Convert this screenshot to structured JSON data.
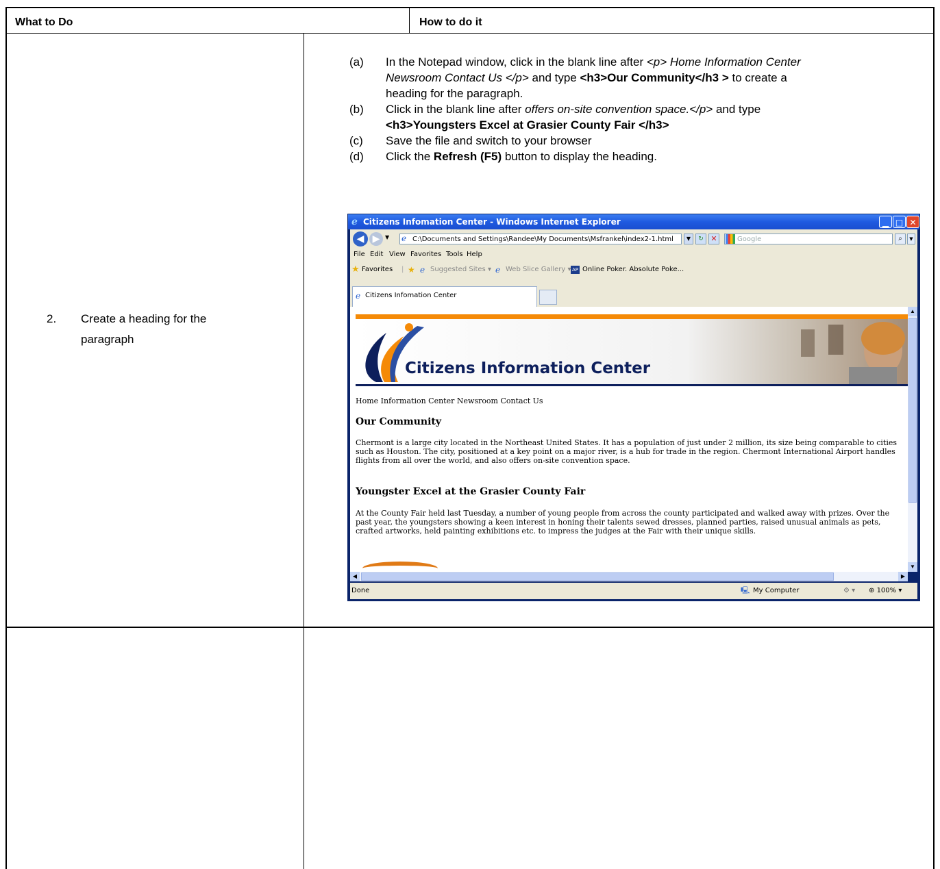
{
  "table": {
    "col1_header": "What to Do",
    "col2_header": "How to do it"
  },
  "step": {
    "number": "2.",
    "text_line1": "Create a heading for the",
    "text_line2": "paragraph"
  },
  "instructions": {
    "a": {
      "label": "(a)",
      "l1_part1": "In the Notepad window, click in the blank line after ",
      "l1_italic": "<p> Home Information Center",
      "l2_italic": "Newsroom Contact Us </p>",
      "l2_mid": " and type ",
      "l2_bold": "<h3>Our Community</h3 >",
      "l2_end": " to create a",
      "l3": "heading for the paragraph."
    },
    "b": {
      "label": "(b)",
      "l1_part1": "Click in the blank line after ",
      "l1_italic": "offers on-site convention space.</p>",
      "l1_end": " and type",
      "l2_bold": "<h3>Youngsters Excel at Grasier County Fair </h3>"
    },
    "c": {
      "label": "(c)",
      "text": "Save the file and switch to your browser"
    },
    "d": {
      "label": "(d)",
      "pre": "Click the ",
      "bold": "Refresh (F5)",
      "post": " button to display the heading."
    }
  },
  "browser": {
    "window_title": "Citizens Infomation Center - Windows Internet Explorer",
    "address": "C:\\Documents and Settings\\Randee\\My Documents\\Msfrankel\\index2-1.html",
    "search_placeholder": "Google",
    "menu": [
      "File",
      "Edit",
      "View",
      "Favorites",
      "Tools",
      "Help"
    ],
    "favorites_label": "Favorites",
    "fav_links": [
      "Suggested Sites",
      "Web Slice Gallery",
      "Online Poker. Absolute Poke..."
    ],
    "tab_label": "Citizens Infomation Center",
    "status_text": "Done",
    "zone": "My Computer",
    "zoom": "100%",
    "page": {
      "banner_text": "Citizens Information Center",
      "nav": "Home Information Center Newsroom Contact Us",
      "h1": "Our Community",
      "p1": "Chermont is a large city located in the Northeast United States. It has a population of just under 2 million, its size being comparable to cities such as Houston. The city, positioned at a key point on a major river, is a hub for trade in the region. Chermont International Airport handles flights from all over the world, and also offers on-site convention space.",
      "h2": "Youngster Excel at the Grasier County Fair",
      "p2": "At the County Fair held last Tuesday, a number of young people from across the county participated and walked away with prizes. Over the past year, the youngsters showing a keen interest in honing their talents sewed dresses, planned parties, raised unusual animals as pets, crafted artworks, held painting exhibitions etc. to impress the judges at the Fair with their unique skills."
    }
  },
  "colors": {
    "ie_title_blue": "#245edb",
    "banner_orange": "#f58a07",
    "banner_navy": "#0d1f5c"
  }
}
